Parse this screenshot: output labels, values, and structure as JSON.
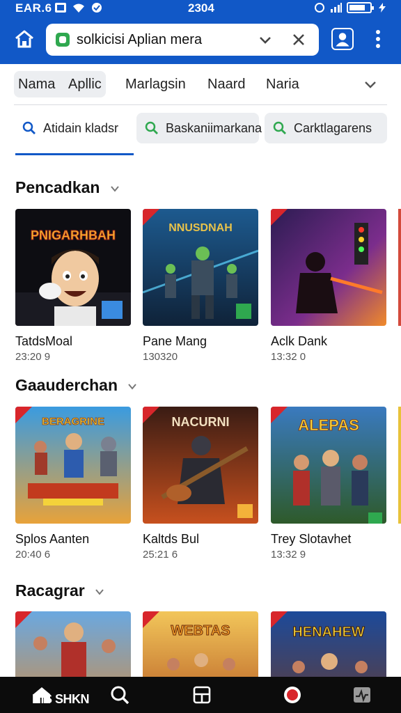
{
  "status": {
    "carrier": "EAR.6",
    "time": "2304"
  },
  "address_bar": {
    "url_text": "solkicisi Aplian mera"
  },
  "categories": {
    "items": [
      "Nama",
      "Apllic",
      "Marlagsin",
      "Naard",
      "Naria"
    ]
  },
  "search_chips": [
    "Atidain kladsr",
    "Baskaniimarkana",
    "Carktlagarens"
  ],
  "sections": [
    {
      "title": "Pencadkan",
      "cards": [
        {
          "name": "TatdsMoal",
          "meta": "23:20 9",
          "art": "PNIGARHBAH"
        },
        {
          "name": "Pane Mang",
          "meta": "130320",
          "art": "NNUSDNAH"
        },
        {
          "name": "Aclk Dank",
          "meta": "13:32 0",
          "art": ""
        }
      ]
    },
    {
      "title": "Gaauderchan",
      "cards": [
        {
          "name": "Splos Aanten",
          "meta": "20:40 6",
          "art": "BERAGRINE"
        },
        {
          "name": "Kaltds Bul",
          "meta": "25:21 6",
          "art": "NACURNI"
        },
        {
          "name": "Trey Slotavhet",
          "meta": "13:32 9",
          "art": "ALEPAS"
        }
      ]
    },
    {
      "title": "Racagrar",
      "cards": [
        {
          "name": "",
          "meta": "",
          "art": ""
        },
        {
          "name": "",
          "meta": "",
          "art": "WEBTAS"
        },
        {
          "name": "",
          "meta": "",
          "art": "HENAHEW"
        }
      ]
    }
  ],
  "bottom_nav": {
    "label": "HIS SHKN"
  },
  "colors": {
    "brand_blue": "#1158c7",
    "chip_gray": "#eceef1",
    "nav_black": "#0c0c0c",
    "search_green": "#2fa84f"
  },
  "icons": [
    "home-icon",
    "lock-icon",
    "chevron-down-icon",
    "close-icon",
    "account-icon",
    "more-vert-icon",
    "search-icon",
    "grid-icon",
    "record-icon",
    "activity-icon"
  ]
}
